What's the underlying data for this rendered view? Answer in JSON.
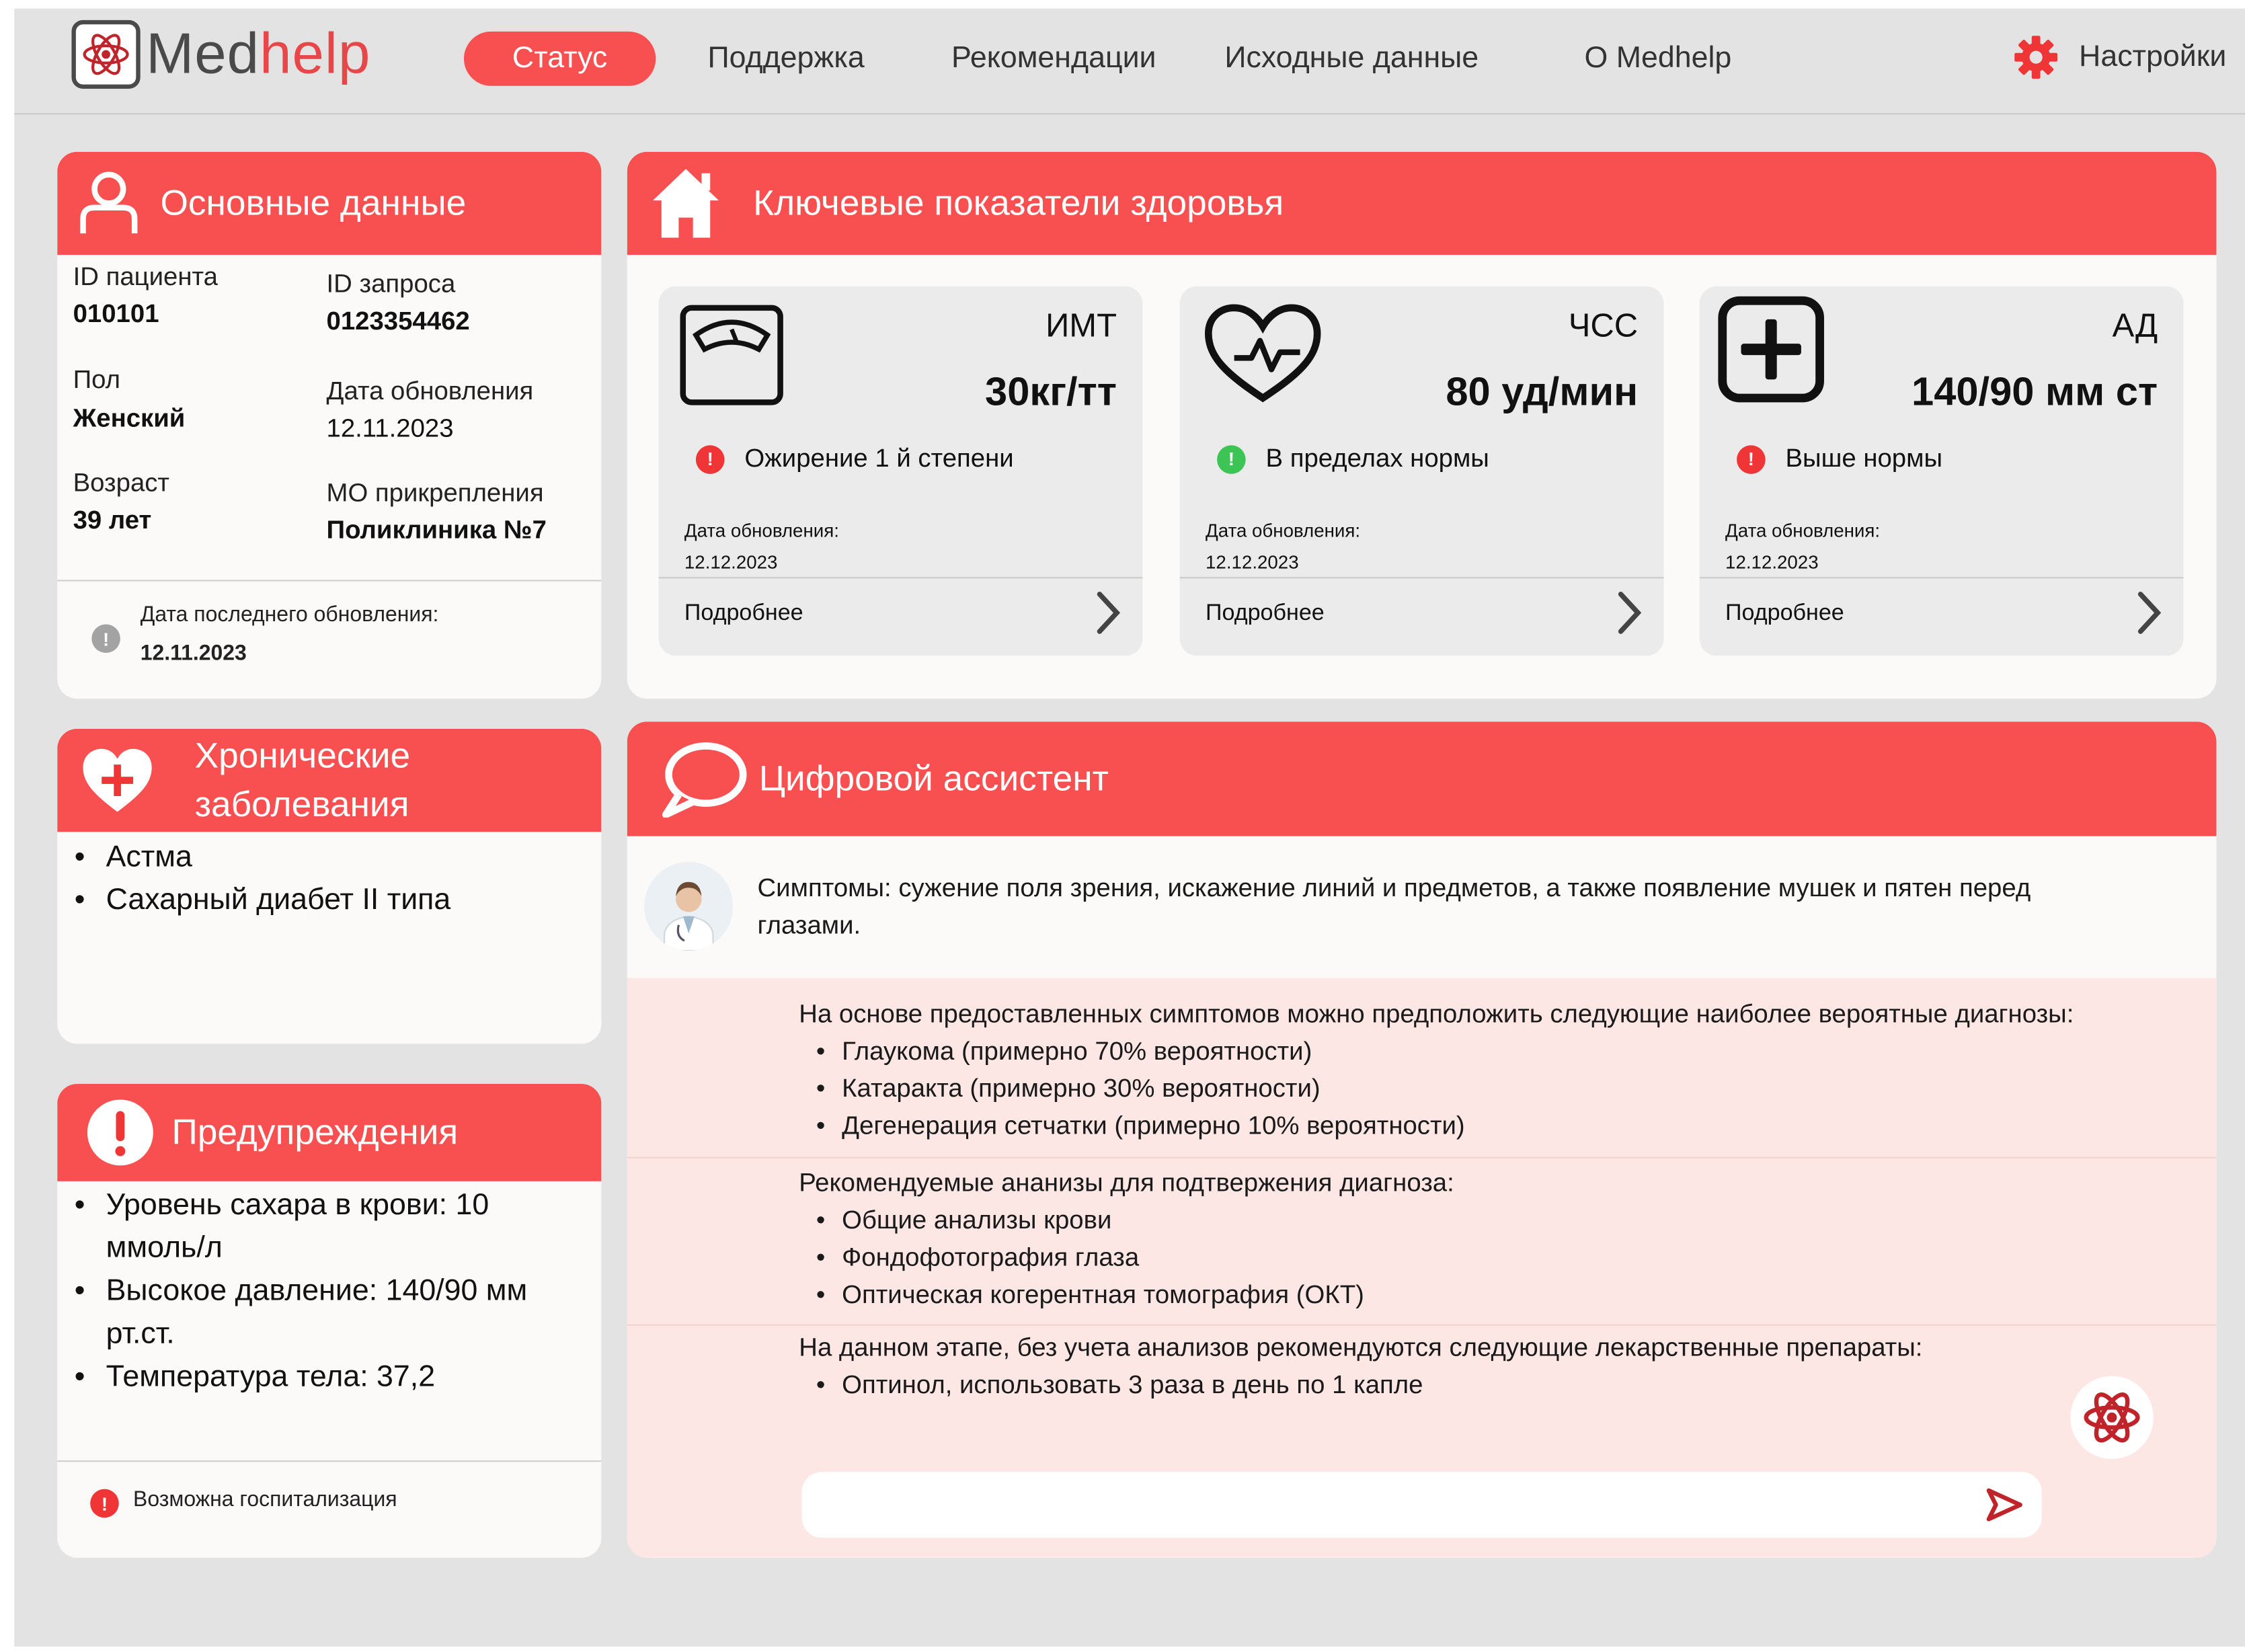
{
  "app": {
    "logo_part1": "Med",
    "logo_part2": "help",
    "nav": [
      "Статус",
      "Поддержка",
      "Рекомендации",
      "Исходные данные",
      "О Medhelp"
    ],
    "settings_label": "Настройки"
  },
  "basic": {
    "title": "Основные данные",
    "patient_id_label": "ID пациента",
    "patient_id": "010101",
    "request_id_label": "ID запроса",
    "request_id": "0123354462",
    "sex_label": "Пол",
    "sex": "Женский",
    "updated_label": "Дата обновления",
    "updated": "12.11.2023",
    "age_label": "Возраст",
    "age": "39 лет",
    "mo_label": "МО прикрепления",
    "mo": "Поликлиника №7",
    "last_update_label": "Дата последнего обновления:",
    "last_update": "12.11.2023"
  },
  "chronic": {
    "title_line1": "Хронические",
    "title_line2": "заболевания",
    "items": [
      "Астма",
      "Сахарный диабет II типа"
    ]
  },
  "warnings": {
    "title": "Предупреждения",
    "items": [
      "Уровень сахара в крови: 10 ммоль/л",
      "Высокое давление: 140/90 мм рт.ст.",
      "Температура тела: 37,2"
    ],
    "footer": "Возможна госпитализация"
  },
  "health": {
    "title": "Ключевые показатели здоровья",
    "metrics": [
      {
        "name": "ИМТ",
        "value": "30кг/тт",
        "status": "Ожирение 1 й степени",
        "status_color": "#ef3535",
        "date_label": "Дата обновления:",
        "date": "12.12.2023",
        "more": "Подробнее"
      },
      {
        "name": "ЧСС",
        "value": "80 уд/мин",
        "status": "В пределах нормы",
        "status_color": "#3cc455",
        "date_label": "Дата обновления:",
        "date": "12.12.2023",
        "more": "Подробнее"
      },
      {
        "name": "АД",
        "value": "140/90 мм ст",
        "status": "Выше нормы",
        "status_color": "#ef3535",
        "date_label": "Дата обновления:",
        "date": "12.12.2023",
        "more": "Подробнее"
      }
    ]
  },
  "assistant": {
    "title": "Цифровой ассистент",
    "user_message": "Симптомы: сужение поля зрения, искажение линий и предметов, а также появление мушек и пятен перед глазами.",
    "diag_intro": "На основе предоставленных симптомов можно предположить следующие наиболее вероятные диагнозы:",
    "diag_items": [
      "Глаукома (примерно 70% вероятности)",
      "Катаракта (примерно 30% вероятности)",
      "Дегенерация сетчатки (примерно 10% вероятности)"
    ],
    "tests_intro": "Рекомендуемые ананизы для подтвержения диагноза:",
    "tests_items": [
      "Общие анализы крови",
      "Фондофотография глаза",
      "Оптическая когерентная томография (ОКТ)"
    ],
    "meds_intro": "На данном этапе, без учета анализов рекомендуются следующие лекарственные препараты:",
    "meds_items": [
      "Оптинол, использовать 3 раза в день по 1 капле"
    ],
    "input_placeholder": ""
  },
  "colors": {
    "accent": "#f85050",
    "card": "#fcf9f9",
    "background": "#e3e3e3",
    "assistant_reply": "#fde7e5"
  }
}
